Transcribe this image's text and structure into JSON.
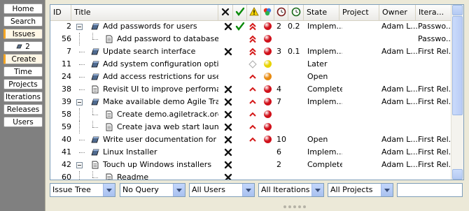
{
  "nav": {
    "items": [
      {
        "label": "Home"
      },
      {
        "label": "Search"
      },
      {
        "label": "Issues",
        "selected": true
      },
      {
        "label": "2",
        "icon": "issue-icon"
      },
      {
        "label": "Create",
        "selected": true
      },
      {
        "label": "Time"
      },
      {
        "label": "Projects"
      },
      {
        "label": "Iterations"
      },
      {
        "label": "Releases"
      },
      {
        "label": "Users"
      }
    ]
  },
  "table": {
    "columns": [
      "ID",
      "Title",
      "State",
      "Project",
      "Owner",
      "Itera..."
    ],
    "header_icons": [
      "close-x-icon",
      "check-icon",
      "warning-icon",
      "colors-icon",
      "clock-icon",
      "clock-green-icon"
    ],
    "rows": [
      {
        "id": "2",
        "title": "Add passwords for users",
        "level": 0,
        "expander": true,
        "icon": "task",
        "x": true,
        "check": true,
        "priority": "double-up",
        "status": "red",
        "num": "2",
        "pct": "0.2",
        "state": "Implem...",
        "owner": "Adam L...",
        "iteration": "Passwo..."
      },
      {
        "id": "56",
        "title": "Add password to database",
        "level": 1,
        "icon": "doc",
        "x": false,
        "check": false,
        "priority": "double-up",
        "status": "red",
        "num": "",
        "pct": "",
        "state": "",
        "owner": "",
        "iteration": "Passwo..."
      },
      {
        "id": "7",
        "title": "Update search interface",
        "level": 0,
        "icon": "task",
        "x": true,
        "check": false,
        "priority": "double-up",
        "status": "red",
        "num": "3",
        "pct": "0.1",
        "state": "Implem...",
        "owner": "Adam L...",
        "iteration": "First Rel..."
      },
      {
        "id": "11",
        "title": "Add system configuration options",
        "level": 0,
        "icon": "task",
        "x": false,
        "check": false,
        "priority": "diamond",
        "status": "yellow",
        "num": "",
        "pct": "",
        "state": "Later",
        "owner": "",
        "iteration": ""
      },
      {
        "id": "24",
        "title": "Add access restrictions for users",
        "level": 0,
        "icon": "task",
        "x": false,
        "check": false,
        "priority": "up",
        "status": "orange",
        "num": "",
        "pct": "",
        "state": "Open",
        "owner": "",
        "iteration": ""
      },
      {
        "id": "38",
        "title": "Revisit UI to improve performance",
        "level": 0,
        "icon": "doc",
        "x": true,
        "check": false,
        "priority": "up",
        "status": "red",
        "num": "4",
        "pct": "",
        "state": "Complete",
        "owner": "Adam L...",
        "iteration": "First Rel..."
      },
      {
        "id": "39",
        "title": "Make available demo Agile Track env",
        "level": 0,
        "expander": true,
        "icon": "task",
        "x": true,
        "check": false,
        "priority": "up",
        "status": "red",
        "num": "7",
        "pct": "",
        "state": "Implem...",
        "owner": "Adam L...",
        "iteration": "First Rel..."
      },
      {
        "id": "58",
        "title": "Create demo.agiletrack.org",
        "level": 1,
        "icon": "doc",
        "x": true,
        "check": false,
        "priority": "up",
        "status": "red",
        "num": "",
        "pct": "",
        "state": "",
        "owner": "",
        "iteration": ""
      },
      {
        "id": "59",
        "title": "Create java web start launcher",
        "level": 1,
        "icon": "doc",
        "x": true,
        "check": false,
        "priority": "up",
        "status": "red",
        "num": "",
        "pct": "",
        "state": "",
        "owner": "",
        "iteration": ""
      },
      {
        "id": "40",
        "title": "Write user documentation for distrib",
        "level": 0,
        "icon": "task",
        "x": true,
        "check": false,
        "priority": "up",
        "status": "red",
        "num": "10",
        "pct": "",
        "state": "Open",
        "owner": "Adam L...",
        "iteration": "First Rel..."
      },
      {
        "id": "41",
        "title": "Linux Installer",
        "level": 0,
        "icon": "task",
        "x": true,
        "check": false,
        "priority": "",
        "status": "",
        "num": "6",
        "pct": "",
        "state": "Implem...",
        "owner": "Adam L...",
        "iteration": "First Rel..."
      },
      {
        "id": "42",
        "title": "Touch up Windows installers",
        "level": 0,
        "expander": true,
        "icon": "doc",
        "x": true,
        "check": false,
        "priority": "",
        "status": "",
        "num": "2",
        "pct": "",
        "state": "Complete",
        "owner": "Adam L...",
        "iteration": "First Rel..."
      },
      {
        "id": "60",
        "title": "Readme",
        "level": 1,
        "icon": "doc",
        "x": true,
        "check": false,
        "priority": "",
        "status": "",
        "num": "",
        "pct": "",
        "state": "",
        "owner": "",
        "iteration": ""
      }
    ]
  },
  "filters": [
    {
      "value": "Issue Tree"
    },
    {
      "value": "No Query"
    },
    {
      "value": "All Users"
    },
    {
      "value": "All Iterations"
    },
    {
      "value": "All Projects"
    },
    {
      "value": ""
    }
  ],
  "colors": {
    "nav_bg": "#808080",
    "accent": "#F5A623",
    "red_status": "#D0101A",
    "yellow_status": "#E8D300",
    "orange_status": "#E88A10",
    "priority_red": "#D41818"
  }
}
